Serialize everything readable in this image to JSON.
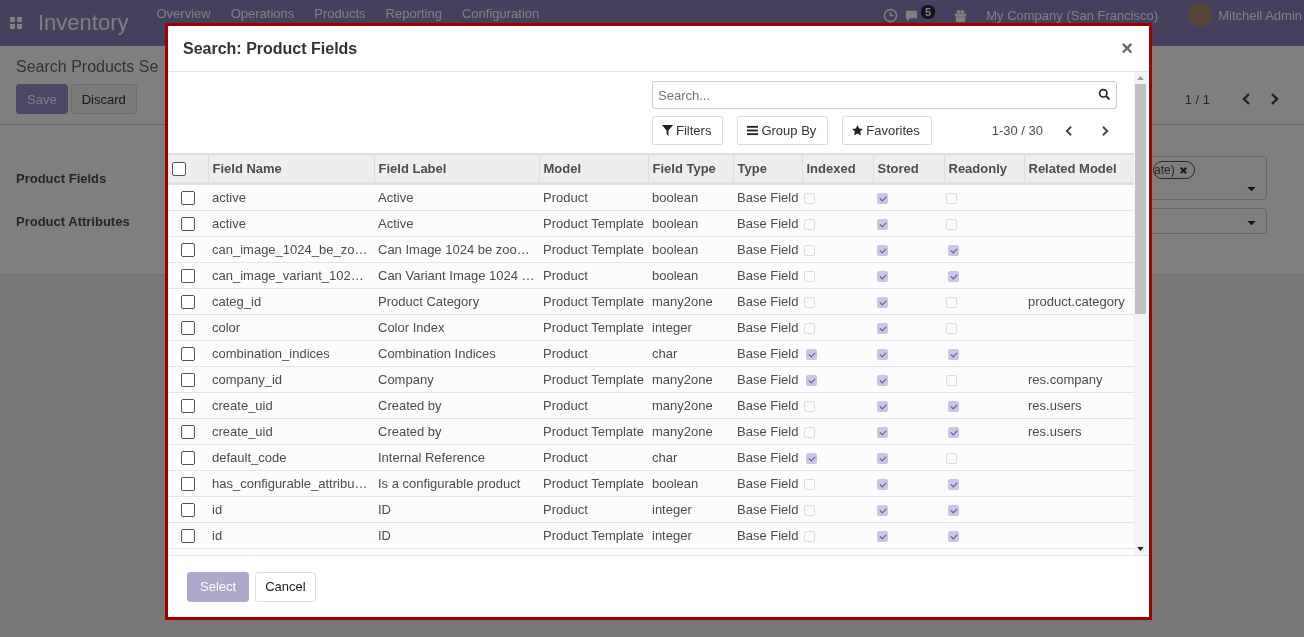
{
  "navbar": {
    "app_name": "Inventory",
    "menu": [
      "Overview",
      "Operations",
      "Products",
      "Reporting",
      "Configuration"
    ],
    "chat_badge": "5",
    "company": "My Company (San Francisco)",
    "user": "Mitchell Admin"
  },
  "page": {
    "title": "Search Products Se",
    "buttons": [
      {
        "label": "Save",
        "primary": true
      },
      {
        "label": "Discard",
        "primary": false
      }
    ],
    "pager": "1 / 1",
    "fields": [
      {
        "label": "Product Fields",
        "tag": "ate)"
      },
      {
        "label": "Product Attributes"
      }
    ]
  },
  "dialog": {
    "title": "Search: Product Fields",
    "close": "×",
    "search": {
      "placeholder": "Search..."
    },
    "filters": [
      {
        "kind": "filter",
        "label": "Filters"
      },
      {
        "kind": "group",
        "label": "Group By"
      },
      {
        "kind": "star",
        "label": "Favorites"
      }
    ],
    "pager": "1-30 / 30",
    "table": {
      "all_selected": false,
      "columns": [
        "Field Name",
        "Field Label",
        "Model",
        "Field Type",
        "Type",
        "Indexed",
        "Stored",
        "Readonly",
        "Related Model"
      ],
      "rows": [
        {
          "name": "active",
          "label": "Active",
          "model": "Product",
          "field_type": "boolean",
          "type": "Base Field",
          "indexed": false,
          "stored": true,
          "readonly": false,
          "selected": false
        },
        {
          "name": "active",
          "label": "Active",
          "model": "Product Template",
          "field_type": "boolean",
          "type": "Base Field",
          "indexed": false,
          "stored": true,
          "readonly": false,
          "selected": false
        },
        {
          "name": "can_image_1024_be_zo…",
          "label": "Can Image 1024 be zoo…",
          "model": "Product Template",
          "field_type": "boolean",
          "type": "Base Field",
          "indexed": false,
          "stored": true,
          "readonly": true,
          "selected": false
        },
        {
          "name": "can_image_variant_102…",
          "label": "Can Variant Image 1024 …",
          "model": "Product",
          "field_type": "boolean",
          "type": "Base Field",
          "indexed": false,
          "stored": true,
          "readonly": true,
          "selected": false
        },
        {
          "name": "categ_id",
          "label": "Product Category",
          "model": "Product Template",
          "field_type": "many2one",
          "type": "Base Field",
          "indexed": false,
          "stored": true,
          "readonly": false,
          "related_model": "product.category",
          "selected": false
        },
        {
          "name": "color",
          "label": "Color Index",
          "model": "Product Template",
          "field_type": "integer",
          "type": "Base Field",
          "indexed": false,
          "stored": true,
          "readonly": false,
          "selected": false
        },
        {
          "name": "combination_indices",
          "label": "Combination Indices",
          "model": "Product",
          "field_type": "char",
          "type": "Base Field",
          "indexed": true,
          "stored": true,
          "readonly": true,
          "selected": false
        },
        {
          "name": "company_id",
          "label": "Company",
          "model": "Product Template",
          "field_type": "many2one",
          "type": "Base Field",
          "indexed": true,
          "stored": true,
          "readonly": false,
          "related_model": "res.company",
          "selected": false
        },
        {
          "name": "create_uid",
          "label": "Created by",
          "model": "Product",
          "field_type": "many2one",
          "type": "Base Field",
          "indexed": false,
          "stored": true,
          "readonly": true,
          "related_model": "res.users",
          "selected": false
        },
        {
          "name": "create_uid",
          "label": "Created by",
          "model": "Product Template",
          "field_type": "many2one",
          "type": "Base Field",
          "indexed": false,
          "stored": true,
          "readonly": true,
          "related_model": "res.users",
          "selected": false
        },
        {
          "name": "default_code",
          "label": "Internal Reference",
          "model": "Product",
          "field_type": "char",
          "type": "Base Field",
          "indexed": true,
          "stored": true,
          "readonly": false,
          "selected": false
        },
        {
          "name": "has_configurable_attribu…",
          "label": "Is a configurable product",
          "model": "Product Template",
          "field_type": "boolean",
          "type": "Base Field",
          "indexed": false,
          "stored": true,
          "readonly": true,
          "selected": false
        },
        {
          "name": "id",
          "label": "ID",
          "model": "Product",
          "field_type": "integer",
          "type": "Base Field",
          "indexed": false,
          "stored": true,
          "readonly": true,
          "selected": false
        },
        {
          "name": "id",
          "label": "ID",
          "model": "Product Template",
          "field_type": "integer",
          "type": "Base Field",
          "indexed": false,
          "stored": true,
          "readonly": true,
          "selected": false
        }
      ]
    },
    "buttons": [
      {
        "label": "Select",
        "primary": true,
        "disabled": true
      },
      {
        "label": "Cancel",
        "primary": false,
        "disabled": false
      }
    ]
  }
}
